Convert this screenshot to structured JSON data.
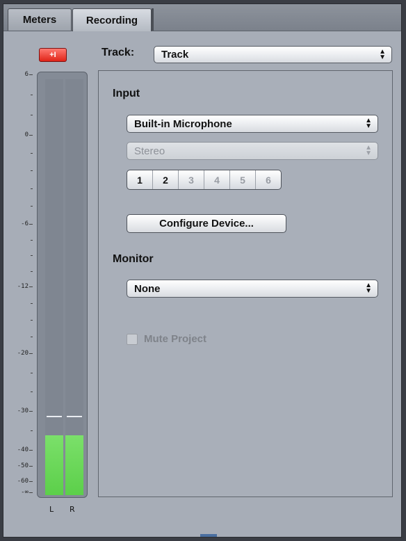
{
  "tabs": {
    "meters": "Meters",
    "recording": "Recording"
  },
  "clip_indicator": "+I",
  "meter": {
    "scale_labels": [
      "6",
      "0",
      "-6",
      "-12",
      "-20",
      "-30",
      "-40",
      "-50",
      "-60",
      "-∞"
    ],
    "left_label": "L",
    "right_label": "R",
    "left_level_db": -36,
    "right_level_db": -36,
    "left_peak_db": -31,
    "right_peak_db": -31
  },
  "track": {
    "label": "Track:",
    "value": "Track"
  },
  "input": {
    "title": "Input",
    "device": "Built-in Microphone",
    "format": "Stereo",
    "channels": [
      "1",
      "2",
      "3",
      "4",
      "5",
      "6"
    ],
    "active_channels": [
      "1",
      "2"
    ],
    "configure_button": "Configure Device..."
  },
  "monitor": {
    "title": "Monitor",
    "value": "None",
    "mute_label": "Mute Project",
    "mute_checked": false
  }
}
